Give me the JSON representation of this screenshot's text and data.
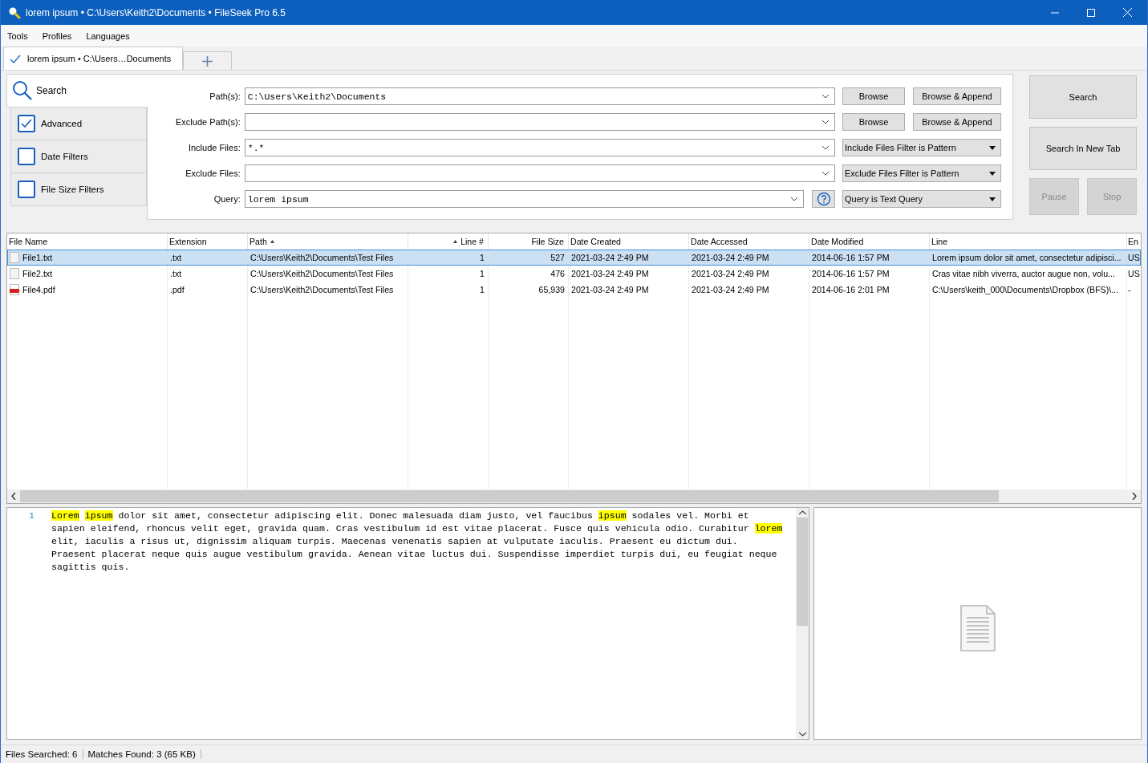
{
  "window": {
    "title": "lorem ipsum • C:\\Users\\Keith2\\Documents • FileSeek Pro 6.5"
  },
  "menu": [
    "Tools",
    "Profiles",
    "Languages"
  ],
  "tabs": [
    {
      "label": "lorem ipsum • C:\\Users…Documents",
      "selected": true
    }
  ],
  "search_tab": {
    "label": "Search"
  },
  "filters": [
    {
      "label": "Advanced",
      "checked": true
    },
    {
      "label": "Date Filters",
      "checked": false
    },
    {
      "label": "File Size Filters",
      "checked": false
    }
  ],
  "form": [
    {
      "label": "Path(s):",
      "value": "C:\\Users\\Keith2\\Documents",
      "buttons": [
        "Browse",
        "Browse & Append"
      ]
    },
    {
      "label": "Exclude Path(s):",
      "buttons": [
        "Browse",
        "Browse & Append"
      ]
    },
    {
      "label": "Include Files:",
      "value": "*.*",
      "dropdown": "Include Files Filter is Pattern"
    },
    {
      "label": "Exclude Files:",
      "dropdown": "Exclude Files Filter is Pattern"
    },
    {
      "label": "Query:",
      "value": "lorem ipsum",
      "help": true,
      "dropdown": "Query is Text Query"
    }
  ],
  "actions": [
    {
      "label": "Search",
      "disabled": false
    },
    {
      "label": "Search In New Tab",
      "disabled": false
    },
    {
      "label": "Pause",
      "disabled": true
    },
    {
      "label": "Stop",
      "disabled": true
    }
  ],
  "table": {
    "columns": [
      {
        "label": "File Name",
        "sorted": false
      },
      {
        "label": "Extension",
        "sorted": false
      },
      {
        "label": "Path",
        "sorted": true
      },
      {
        "label": "Line #",
        "sorted": true
      },
      {
        "label": "File Size",
        "sorted": false
      },
      {
        "label": "Date Created",
        "sorted": false
      },
      {
        "label": "Date Accessed",
        "sorted": false
      },
      {
        "label": "Date Modified",
        "sorted": false
      },
      {
        "label": "Line",
        "sorted": false
      },
      {
        "label": "En",
        "sorted": false
      }
    ],
    "rows": [
      {
        "kind": "text",
        "selected": true,
        "cells": [
          "File1.txt",
          ".txt",
          "C:\\Users\\Keith2\\Documents\\Test Files",
          "1",
          "527",
          "2021-03-24 2:49 PM",
          "2021-03-24 2:49 PM",
          "2014-06-16 1:57 PM",
          "Lorem ipsum dolor sit amet, consectetur adipisci...",
          "US"
        ]
      },
      {
        "kind": "text",
        "selected": false,
        "cells": [
          "File2.txt",
          ".txt",
          "C:\\Users\\Keith2\\Documents\\Test Files",
          "1",
          "476",
          "2021-03-24 2:49 PM",
          "2021-03-24 2:49 PM",
          "2014-06-16 1:57 PM",
          "Cras vitae nibh viverra, auctor augue non, volu...",
          "US"
        ]
      },
      {
        "kind": "pdf",
        "selected": false,
        "cells": [
          "File4.pdf",
          ".pdf",
          "C:\\Users\\Keith2\\Documents\\Test Files",
          "1",
          "65,939",
          "2021-03-24 2:49 PM",
          "2021-03-24 2:49 PM",
          "2014-06-16 2:01 PM",
          "C:\\Users\\keith_000\\Documents\\Dropbox (BFS)\\...",
          "-"
        ]
      }
    ]
  },
  "preview": {
    "line_number": "1",
    "lines": [
      [
        {
          "text": "Lorem",
          "highlight": true
        },
        {
          "text": "ipsum",
          "highlight": true,
          "space_before": true
        },
        {
          "text": " dolor sit amet, consectetur adipiscing elit. Donec malesuada diam justo, vel faucibus ",
          "highlight": false
        },
        {
          "text": "ipsum",
          "highlight": true
        },
        {
          "text": " sodales vel. Morbi et",
          "highlight": false
        }
      ],
      [
        {
          "text": "sapien eleifend, rhoncus velit eget, gravida quam. Cras vestibulum id est vitae placerat. Fusce quis vehicula odio. Curabitur ",
          "highlight": false
        },
        {
          "text": "lorem",
          "highlight": true
        }
      ],
      [
        {
          "text": "elit, iaculis a risus ut, dignissim aliquam turpis. Maecenas venenatis sapien at vulputate iaculis. Praesent eu dictum dui.",
          "highlight": false
        }
      ],
      [
        {
          "text": "Praesent placerat neque quis augue vestibulum gravida. Aenean vitae luctus dui. Suspendisse imperdiet turpis dui, eu feugiat neque",
          "highlight": false
        }
      ],
      [
        {
          "text": "sagittis quis.",
          "highlight": false
        }
      ]
    ]
  },
  "status_bar": [
    "Files Searched: 6",
    "Matches Found: 3 (65 KB)"
  ]
}
